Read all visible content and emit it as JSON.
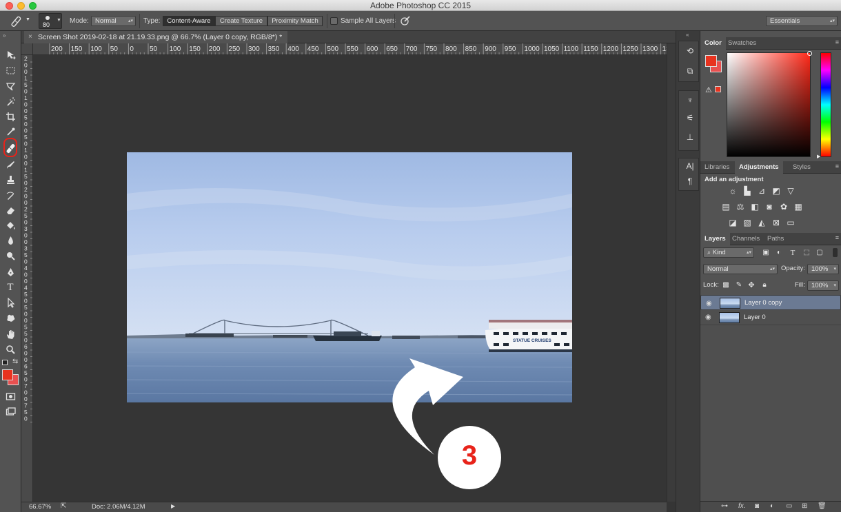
{
  "app_title": "Adobe Photoshop CC 2015",
  "options_bar": {
    "brush_size": "80",
    "mode_label": "Mode:",
    "mode_value": "Normal",
    "type_label": "Type:",
    "type_buttons": [
      "Content-Aware",
      "Create Texture",
      "Proximity Match"
    ],
    "sample_all_layers": "Sample All Layers",
    "workspace": "Essentials"
  },
  "document": {
    "tab_title": "Screen Shot 2019-02-18 at 21.19.33.png @ 66.7% (Layer 0 copy, RGB/8*) *",
    "close_glyph": "×"
  },
  "rulers": {
    "horizontal": [
      "200",
      "150",
      "100",
      "50",
      "0",
      "50",
      "100",
      "150",
      "200",
      "250",
      "300",
      "350",
      "400",
      "450",
      "500",
      "550",
      "600",
      "650",
      "700",
      "750",
      "800",
      "850",
      "900",
      "950",
      "1000",
      "1050",
      "1100",
      "1150",
      "1200",
      "1250",
      "1300",
      "13"
    ],
    "vertical": [
      "2",
      "0",
      "0",
      "1",
      "5",
      "0",
      "1",
      "0",
      "0",
      "5",
      "0",
      "0",
      "5",
      "0",
      "1",
      "0",
      "0",
      "1",
      "5",
      "0",
      "2",
      "0",
      "0",
      "2",
      "5",
      "0",
      "3",
      "0",
      "0",
      "3",
      "5",
      "0",
      "4",
      "0",
      "0",
      "4",
      "5",
      "0",
      "5",
      "0",
      "0",
      "5",
      "5",
      "0",
      "6",
      "0",
      "0",
      "6",
      "5",
      "0",
      "7",
      "0",
      "0",
      "7",
      "5",
      "0"
    ]
  },
  "photo_text": "STATUE CRUISES",
  "annotation": {
    "number": "3",
    "color": "#e8231a"
  },
  "status_bar": {
    "zoom": "66.67%",
    "doc": "Doc: 2.06M/4.12M"
  },
  "colors": {
    "foreground": "#e8331f",
    "background": "#e85050"
  },
  "panels": {
    "color_tabs": [
      "Color",
      "Swatches"
    ],
    "adjustments_tabs": [
      "Libraries",
      "Adjustments",
      "Styles"
    ],
    "add_adjustment": "Add an adjustment",
    "layers_tabs": [
      "Layers",
      "Channels",
      "Paths"
    ],
    "filter_kind": "Kind",
    "blend_mode": "Normal",
    "opacity_label": "Opacity:",
    "opacity_value": "100%",
    "lock_label": "Lock:",
    "fill_label": "Fill:",
    "fill_value": "100%",
    "layers": [
      {
        "name": "Layer 0 copy",
        "selected": true
      },
      {
        "name": "Layer 0",
        "selected": false
      }
    ]
  }
}
